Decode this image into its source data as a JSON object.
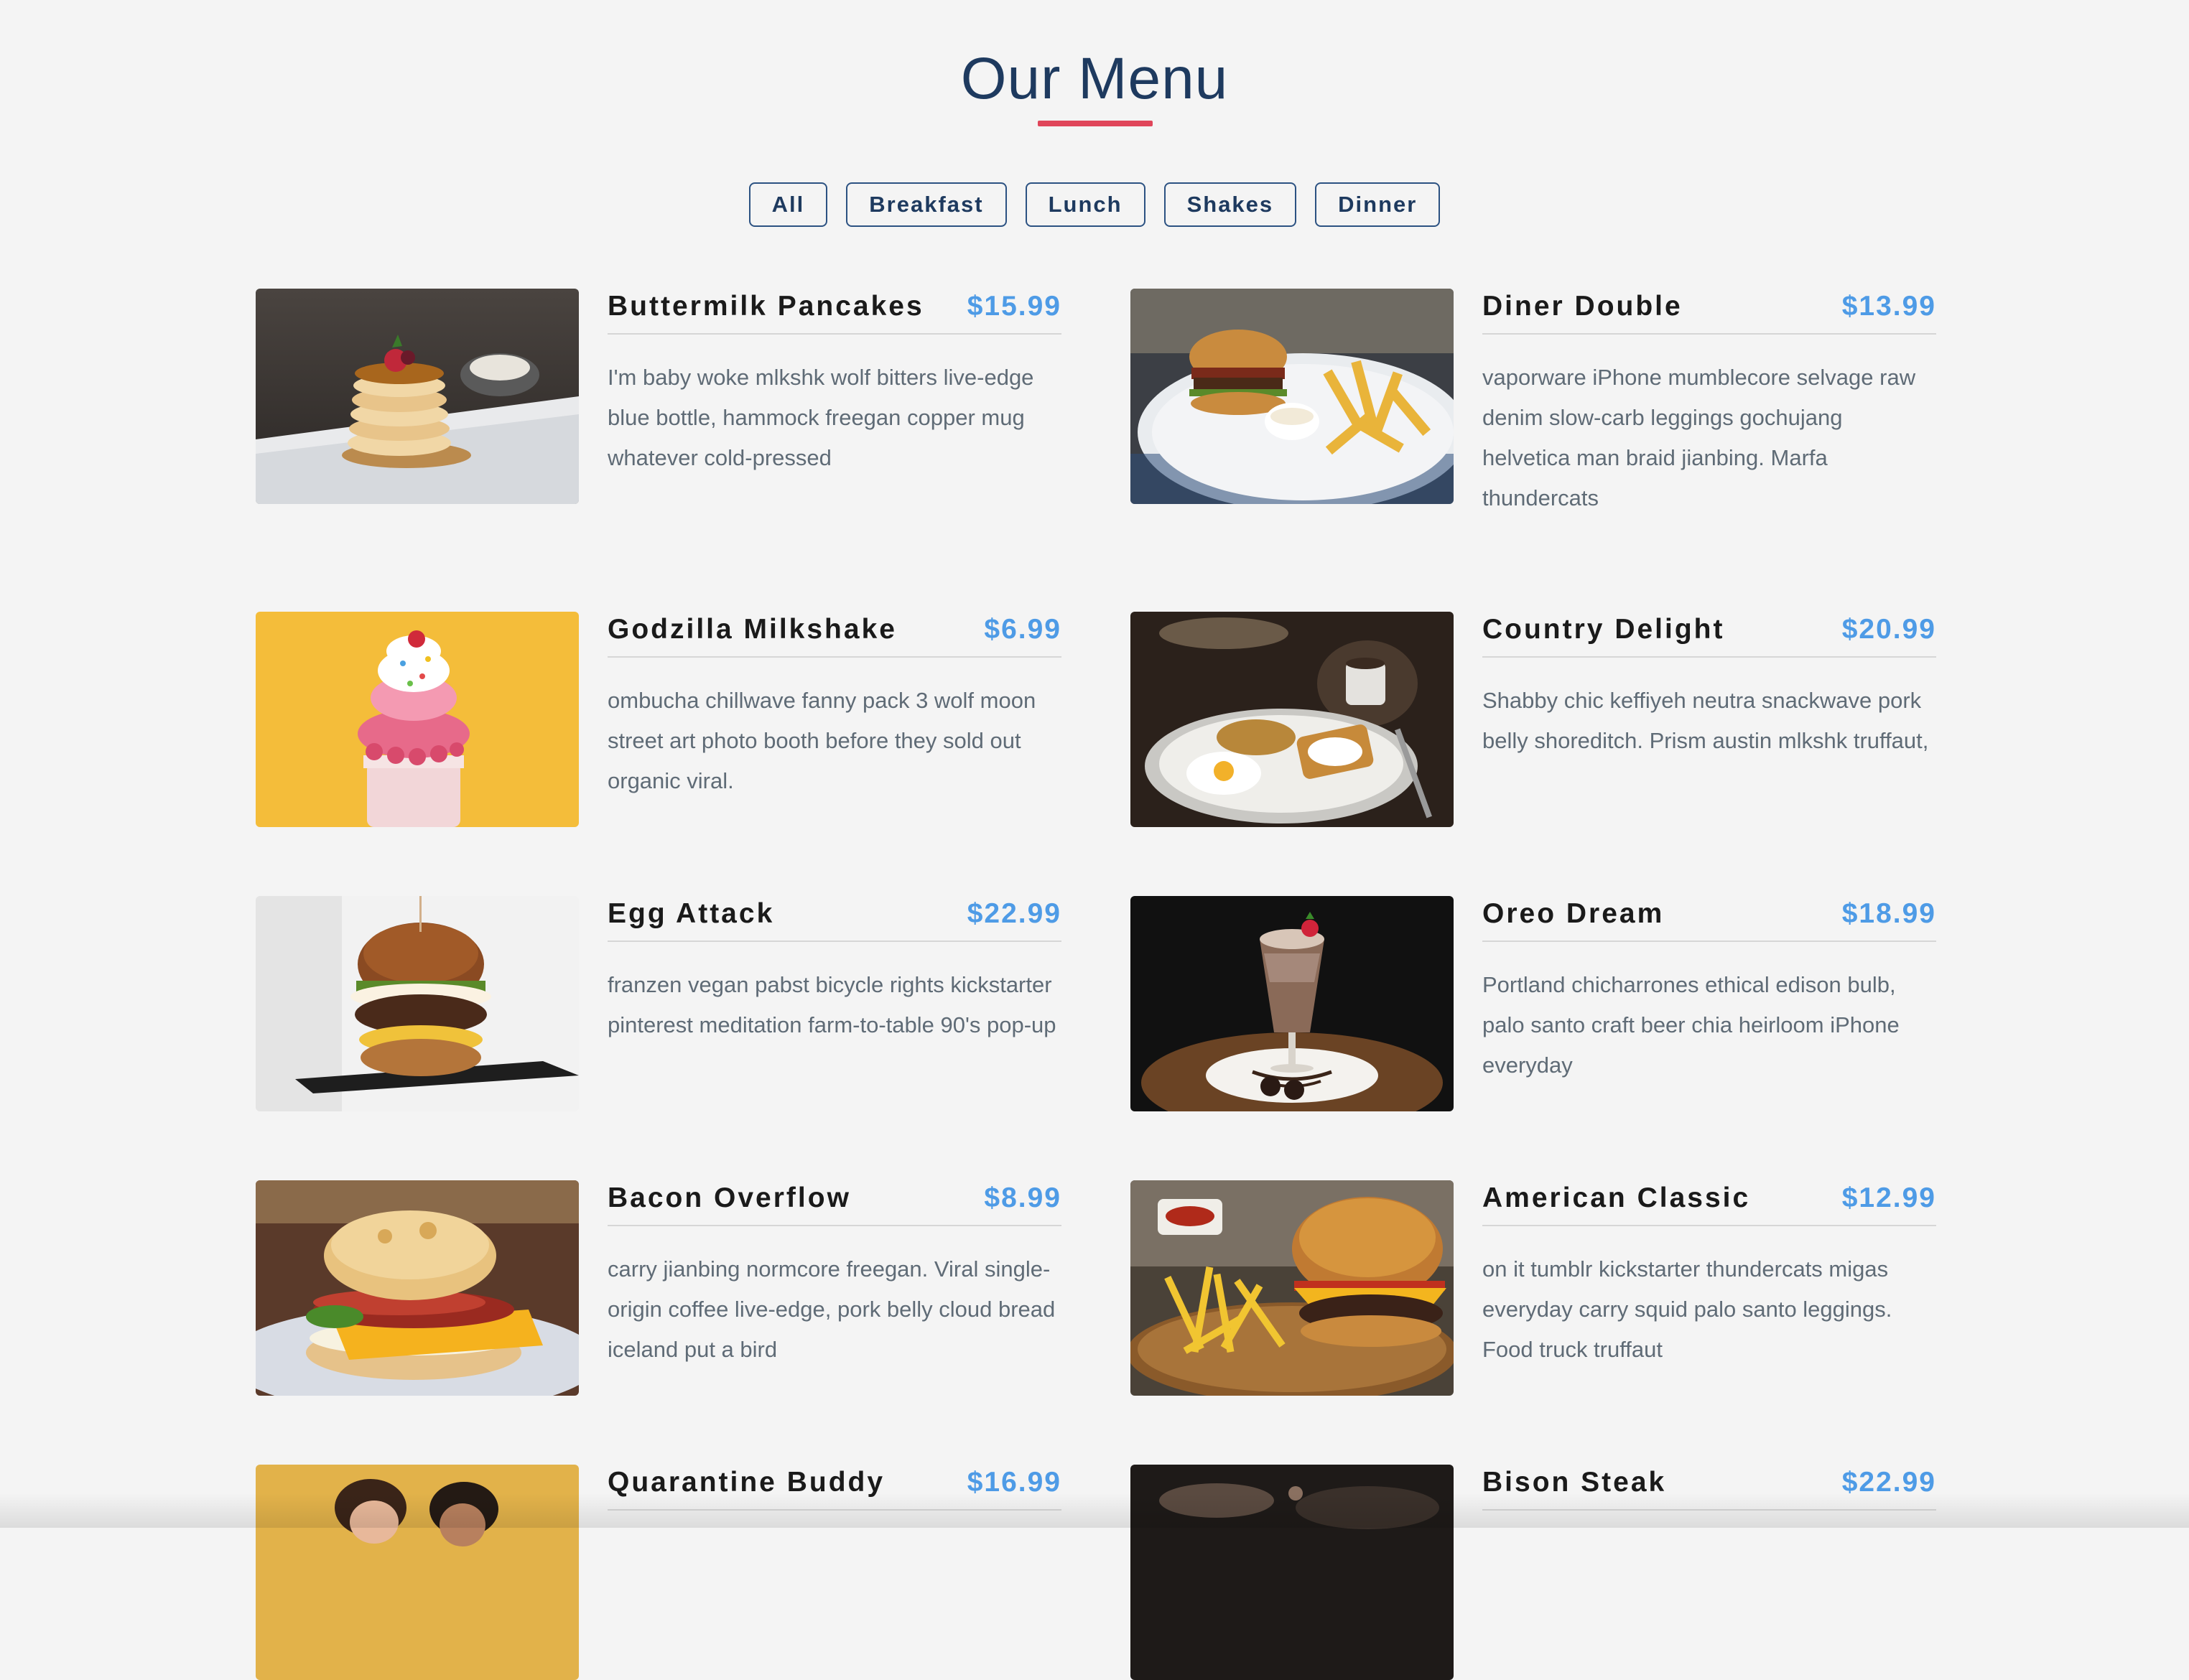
{
  "page": {
    "title": "Our Menu"
  },
  "colors": {
    "title": "#1e3a5f",
    "underline": "#e0465a",
    "price": "#4e9be6",
    "filter_border": "#2c5282",
    "text_muted": "#5f6b76",
    "background": "#f4f4f4"
  },
  "filters": [
    {
      "label": "All"
    },
    {
      "label": "Breakfast"
    },
    {
      "label": "Lunch"
    },
    {
      "label": "Shakes"
    },
    {
      "label": "Dinner"
    }
  ],
  "items": [
    {
      "name": "Buttermilk Pancakes",
      "price": "$15.99",
      "description": "I'm baby woke mlkshk wolf bitters live-edge blue bottle, hammock freegan copper mug whatever cold-pressed",
      "image": "pancakes-photo"
    },
    {
      "name": "Diner Double",
      "price": "$13.99",
      "description": "vaporware iPhone mumblecore selvage raw denim slow-carb leggings gochujang helvetica man braid jianbing. Marfa thundercats",
      "image": "burger-fries-photo"
    },
    {
      "name": "Godzilla Milkshake",
      "price": "$6.99",
      "description": "ombucha chillwave fanny pack 3 wolf moon street art photo booth before they sold out organic viral.",
      "image": "milkshake-photo"
    },
    {
      "name": "Country Delight",
      "price": "$20.99",
      "description": "Shabby chic keffiyeh neutra snackwave pork belly shoreditch. Prism austin mlkshk truffaut,",
      "image": "breakfast-plate-photo"
    },
    {
      "name": "Egg Attack",
      "price": "$22.99",
      "description": "franzen vegan pabst bicycle rights kickstarter pinterest meditation farm-to-table 90's pop-up",
      "image": "egg-burger-photo"
    },
    {
      "name": "Oreo Dream",
      "price": "$18.99",
      "description": "Portland chicharrones ethical edison bulb, palo santo craft beer chia heirloom iPhone everyday",
      "image": "oreo-shake-photo"
    },
    {
      "name": "Bacon Overflow",
      "price": "$8.99",
      "description": "carry jianbing normcore freegan. Viral single-origin coffee live-edge, pork belly cloud bread iceland put a bird",
      "image": "bacon-biscuit-photo"
    },
    {
      "name": "American Classic",
      "price": "$12.99",
      "description": "on it tumblr kickstarter thundercats migas everyday carry squid palo santo leggings. Food truck truffaut",
      "image": "classic-burger-photo"
    },
    {
      "name": "Quarantine Buddy",
      "price": "$16.99",
      "description": "",
      "image": "people-photo"
    },
    {
      "name": "Bison Steak",
      "price": "$22.99",
      "description": "",
      "image": "steak-photo"
    }
  ]
}
